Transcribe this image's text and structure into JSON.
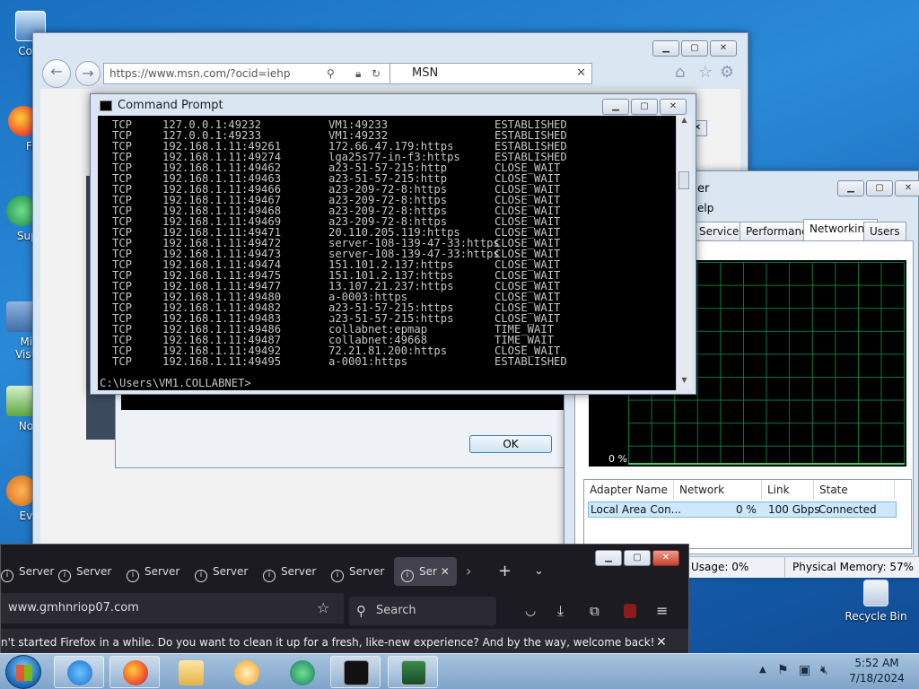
{
  "desktop": {
    "icons": [
      {
        "label": "Com",
        "name": "computer"
      },
      {
        "label": "Fir",
        "name": "firefox"
      },
      {
        "label": "Supe",
        "name": "super"
      },
      {
        "label": "Micr Visual",
        "name": "visual-studio"
      },
      {
        "label": "Note",
        "name": "notepad"
      },
      {
        "label": "Ever",
        "name": "everything"
      }
    ],
    "recycle_bin": "Recycle Bin"
  },
  "ie": {
    "url": "https://www.msn.com/?ocid=iehp",
    "tab_title": "MSN"
  },
  "dialog": {
    "console_text": "... ... .. ..... ........",
    "ok_label": "OK"
  },
  "task_manager": {
    "title_fragment": "er",
    "menu_fragment": "elp",
    "tabs": [
      "Services",
      "Performance",
      "Networking",
      "Users"
    ],
    "active_tab": "Networking",
    "graph_percent": "0 %",
    "columns": [
      "Adapter Name",
      "Network Utiliza...",
      "Link Sp...",
      "State"
    ],
    "adapter": {
      "name": "Local Area Con...",
      "utilization": "0 %",
      "speed": "100 Gbps",
      "state": "Connected"
    },
    "status": {
      "cpu": "Usage: 0%",
      "memory": "Physical Memory: 57%"
    }
  },
  "cmd": {
    "title": "Command Prompt",
    "rows": [
      [
        "TCP",
        "127.0.0.1:49232",
        "VM1:49233",
        "ESTABLISHED"
      ],
      [
        "TCP",
        "127.0.0.1:49233",
        "VM1:49232",
        "ESTABLISHED"
      ],
      [
        "TCP",
        "192.168.1.11:49261",
        "172.66.47.179:https",
        "ESTABLISHED"
      ],
      [
        "TCP",
        "192.168.1.11:49274",
        "lga25s77-in-f3:https",
        "ESTABLISHED"
      ],
      [
        "TCP",
        "192.168.1.11:49462",
        "a23-51-57-215:http",
        "CLOSE_WAIT"
      ],
      [
        "TCP",
        "192.168.1.11:49463",
        "a23-51-57-215:http",
        "CLOSE_WAIT"
      ],
      [
        "TCP",
        "192.168.1.11:49466",
        "a23-209-72-8:https",
        "CLOSE_WAIT"
      ],
      [
        "TCP",
        "192.168.1.11:49467",
        "a23-209-72-8:https",
        "CLOSE_WAIT"
      ],
      [
        "TCP",
        "192.168.1.11:49468",
        "a23-209-72-8:https",
        "CLOSE_WAIT"
      ],
      [
        "TCP",
        "192.168.1.11:49469",
        "a23-209-72-8:https",
        "CLOSE_WAIT"
      ],
      [
        "TCP",
        "192.168.1.11:49471",
        "20.110.205.119:https",
        "CLOSE_WAIT"
      ],
      [
        "TCP",
        "192.168.1.11:49472",
        "server-108-139-47-33:https",
        "CLOSE_WAIT"
      ],
      [
        "TCP",
        "192.168.1.11:49473",
        "server-108-139-47-33:https",
        "CLOSE_WAIT"
      ],
      [
        "TCP",
        "192.168.1.11:49474",
        "151.101.2.137:https",
        "CLOSE_WAIT"
      ],
      [
        "TCP",
        "192.168.1.11:49475",
        "151.101.2.137:https",
        "CLOSE_WAIT"
      ],
      [
        "TCP",
        "192.168.1.11:49477",
        "13.107.21.237:https",
        "CLOSE_WAIT"
      ],
      [
        "TCP",
        "192.168.1.11:49480",
        "a-0003:https",
        "CLOSE_WAIT"
      ],
      [
        "TCP",
        "192.168.1.11:49482",
        "a23-51-57-215:https",
        "CLOSE_WAIT"
      ],
      [
        "TCP",
        "192.168.1.11:49483",
        "a23-51-57-215:https",
        "CLOSE_WAIT"
      ],
      [
        "TCP",
        "192.168.1.11:49486",
        "collabnet:epmap",
        "TIME_WAIT"
      ],
      [
        "TCP",
        "192.168.1.11:49487",
        "collabnet:49668",
        "TIME_WAIT"
      ],
      [
        "TCP",
        "192.168.1.11:49492",
        "72.21.81.200:https",
        "CLOSE_WAIT"
      ],
      [
        "TCP",
        "192.168.1.11:49495",
        "a-0001:https",
        "ESTABLISHED"
      ]
    ],
    "prompt": "C:\\Users\\VM1.COLLABNET>"
  },
  "firefox": {
    "tabs": [
      "Server",
      "Server",
      "Server",
      "Server",
      "Server",
      "Server",
      "Ser"
    ],
    "url": "www.gmhnriop07.com",
    "search_placeholder": "Search",
    "notice": "n't started Firefox in a while. Do you want to clean it up for a fresh, like-new experience? And by the way, welcome back!"
  },
  "taskbar": {
    "time": "5:52 AM",
    "date": "7/18/2024"
  },
  "colors": {
    "desktop": "#1e74c4",
    "cmd_bg": "#000000",
    "graph_grid": "#0d7a3c",
    "firefox_bg": "#1c1b22"
  }
}
